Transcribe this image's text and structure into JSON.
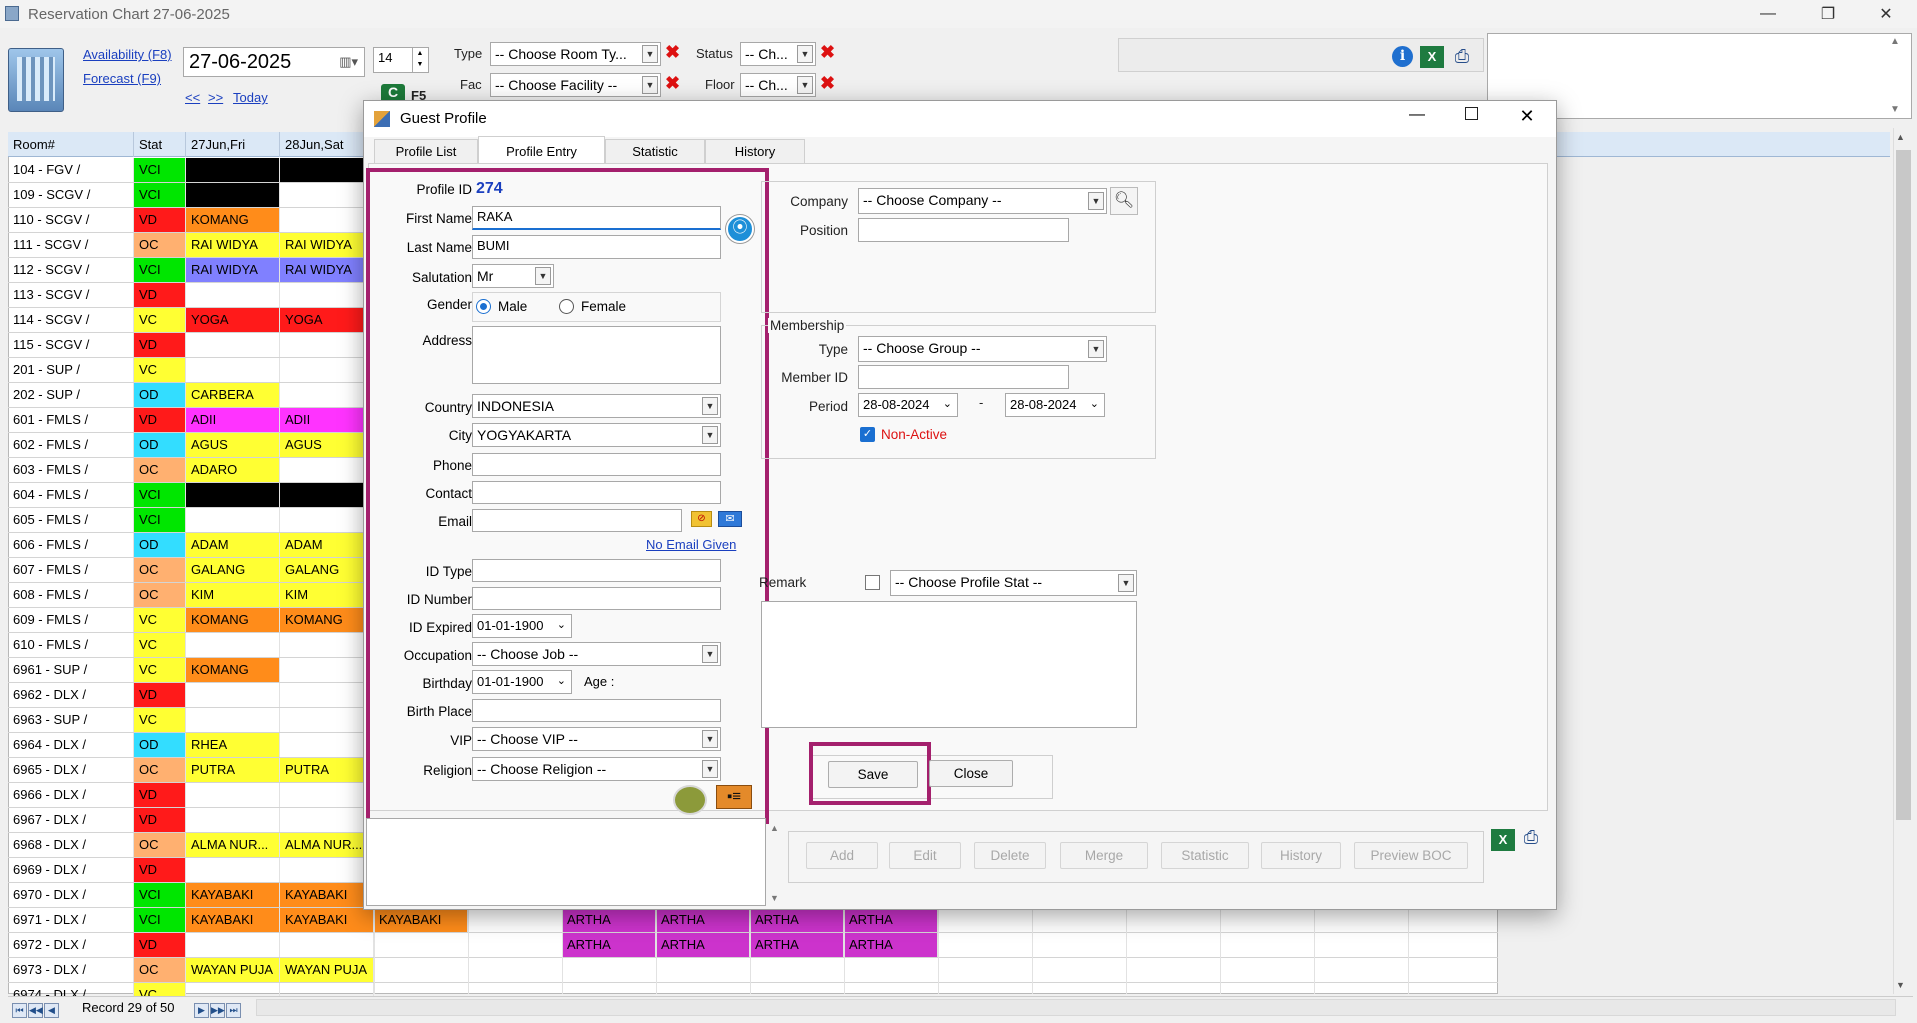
{
  "window": {
    "title": "Reservation Chart 27-06-2025",
    "min": "—",
    "max": "❐",
    "close": "✕"
  },
  "toolbar": {
    "availability": "Availability (F8)",
    "forecast": "Forecast (F9)",
    "prev": "<<",
    "next": ">>",
    "today": "Today",
    "date": "27-06-2025",
    "days": "14",
    "refresh_key": "F5",
    "type_label": "Type",
    "type_value": "-- Choose Room Ty...",
    "fac_label": "Fac",
    "fac_value": "-- Choose Facility --",
    "status_label": "Status",
    "status_value": "-- Ch...",
    "floor_label": "Floor",
    "floor_value": "-- Ch..."
  },
  "grid": {
    "headers": [
      "Room#",
      "Stat",
      "27Jun,Fri",
      "28Jun,Sat"
    ],
    "rows": [
      {
        "room": "104 - FGV /",
        "stat": "VCI",
        "sc": "#00e600",
        "c1": "",
        "c1c": "#000000",
        "c2": "",
        "c2c": "#000000"
      },
      {
        "room": "109 - SCGV /",
        "stat": "VCI",
        "sc": "#00e600",
        "c1": "",
        "c1c": "#000000",
        "c2": "",
        "c2c": ""
      },
      {
        "room": "110 - SCGV /",
        "stat": "VD",
        "sc": "#ff1a1a",
        "c1": "KOMANG",
        "c1c": "#ff8c1a",
        "c2": "",
        "c2c": ""
      },
      {
        "room": "111 - SCGV /",
        "stat": "OC",
        "sc": "#ffb070",
        "c1": "RAI WIDYA",
        "c1c": "#ffff33",
        "c2": "RAI WIDYA",
        "c2c": "#ffff33"
      },
      {
        "room": "112 - SCGV /",
        "stat": "VCI",
        "sc": "#00e600",
        "c1": "RAI WIDYA",
        "c1c": "#8080ff",
        "c2": "RAI WIDYA",
        "c2c": "#8080ff"
      },
      {
        "room": "113 - SCGV /",
        "stat": "VD",
        "sc": "#ff1a1a",
        "c1": "",
        "c1c": "",
        "c2": "",
        "c2c": ""
      },
      {
        "room": "114 - SCGV /",
        "stat": "VC",
        "sc": "#ffff33",
        "c1": "YOGA",
        "c1c": "#ff1a1a",
        "c2": "YOGA",
        "c2c": "#ff1a1a"
      },
      {
        "room": "115 - SCGV /",
        "stat": "VD",
        "sc": "#ff1a1a",
        "c1": "",
        "c1c": "",
        "c2": "",
        "c2c": ""
      },
      {
        "room": "201 - SUP /",
        "stat": "VC",
        "sc": "#ffff33",
        "c1": "",
        "c1c": "",
        "c2": "",
        "c2c": ""
      },
      {
        "room": "202 - SUP /",
        "stat": "OD",
        "sc": "#33ddff",
        "c1": "CARBERA",
        "c1c": "#ffff33",
        "c2": "",
        "c2c": ""
      },
      {
        "room": "601 - FMLS /",
        "stat": "VD",
        "sc": "#ff1a1a",
        "c1": "ADII",
        "c1c": "#ff33ff",
        "c2": "ADII",
        "c2c": "#ff33ff"
      },
      {
        "room": "602 - FMLS /",
        "stat": "OD",
        "sc": "#33ddff",
        "c1": "AGUS",
        "c1c": "#ffff33",
        "c2": "AGUS",
        "c2c": "#ffff33"
      },
      {
        "room": "603 - FMLS /",
        "stat": "OC",
        "sc": "#ffb070",
        "c1": "ADARO",
        "c1c": "#ffff33",
        "c2": "",
        "c2c": ""
      },
      {
        "room": "604 - FMLS /",
        "stat": "VCI",
        "sc": "#00e600",
        "c1": "",
        "c1c": "#000000",
        "c2": "",
        "c2c": "#000000"
      },
      {
        "room": "605 - FMLS /",
        "stat": "VCI",
        "sc": "#00e600",
        "c1": "",
        "c1c": "",
        "c2": "",
        "c2c": ""
      },
      {
        "room": "606 - FMLS /",
        "stat": "OD",
        "sc": "#33ddff",
        "c1": "ADAM",
        "c1c": "#ffff33",
        "c2": "ADAM",
        "c2c": "#ffff33"
      },
      {
        "room": "607 - FMLS /",
        "stat": "OC",
        "sc": "#ffb070",
        "c1": "GALANG",
        "c1c": "#ffff33",
        "c2": "GALANG",
        "c2c": "#ffff33"
      },
      {
        "room": "608 - FMLS /",
        "stat": "OC",
        "sc": "#ffb070",
        "c1": "KIM",
        "c1c": "#ffff33",
        "c2": "KIM",
        "c2c": "#ffff33"
      },
      {
        "room": "609 - FMLS /",
        "stat": "VC",
        "sc": "#ffff33",
        "c1": "KOMANG",
        "c1c": "#ff8c1a",
        "c2": "KOMANG",
        "c2c": "#ff8c1a"
      },
      {
        "room": "610 - FMLS /",
        "stat": "VC",
        "sc": "#ffff33",
        "c1": "",
        "c1c": "",
        "c2": "",
        "c2c": ""
      },
      {
        "room": "6961 - SUP /",
        "stat": "VC",
        "sc": "#ffff33",
        "c1": "KOMANG",
        "c1c": "#ff8c1a",
        "c2": "",
        "c2c": ""
      },
      {
        "room": "6962 - DLX /",
        "stat": "VD",
        "sc": "#ff1a1a",
        "c1": "",
        "c1c": "",
        "c2": "",
        "c2c": ""
      },
      {
        "room": "6963 - SUP /",
        "stat": "VC",
        "sc": "#ffff33",
        "c1": "",
        "c1c": "",
        "c2": "",
        "c2c": ""
      },
      {
        "room": "6964 - DLX /",
        "stat": "OD",
        "sc": "#33ddff",
        "c1": "RHEA",
        "c1c": "#ffff33",
        "c2": "",
        "c2c": ""
      },
      {
        "room": "6965 - DLX /",
        "stat": "OC",
        "sc": "#ffb070",
        "c1": "PUTRA",
        "c1c": "#ffff33",
        "c2": "PUTRA",
        "c2c": "#ffff33"
      },
      {
        "room": "6966 - DLX /",
        "stat": "VD",
        "sc": "#ff1a1a",
        "c1": "",
        "c1c": "",
        "c2": "",
        "c2c": ""
      },
      {
        "room": "6967 - DLX /",
        "stat": "VD",
        "sc": "#ff1a1a",
        "c1": "",
        "c1c": "",
        "c2": "",
        "c2c": ""
      },
      {
        "room": "6968 - DLX /",
        "stat": "OC",
        "sc": "#ffb070",
        "c1": "ALMA NUR...",
        "c1c": "#ffff33",
        "c2": "ALMA NUR...",
        "c2c": "#ffff33"
      },
      {
        "room": "6969 - DLX /",
        "stat": "VD",
        "sc": "#ff1a1a",
        "c1": "",
        "c1c": "",
        "c2": "",
        "c2c": ""
      },
      {
        "room": "6970 - DLX /",
        "stat": "VCI",
        "sc": "#00e600",
        "c1": "KAYABAKI",
        "c1c": "#ff8c1a",
        "c2": "KAYABAKI",
        "c2c": "#ff8c1a"
      },
      {
        "room": "6971 - DLX /",
        "stat": "VCI",
        "sc": "#00e600",
        "c1": "KAYABAKI",
        "c1c": "#ff8c1a",
        "c2": "KAYABAKI",
        "c2c": "#ff8c1a"
      },
      {
        "room": "6972 - DLX /",
        "stat": "VD",
        "sc": "#ff1a1a",
        "c1": "",
        "c1c": "",
        "c2": "",
        "c2c": ""
      },
      {
        "room": "6973 - DLX /",
        "stat": "OC",
        "sc": "#ffb070",
        "c1": "WAYAN PUJA",
        "c1c": "#ffff33",
        "c2": "WAYAN PUJA",
        "c2c": "#ffff33"
      },
      {
        "room": "6974 - DLX /",
        "stat": "VC",
        "sc": "#ffff33",
        "c1": "",
        "c1c": "",
        "c2": "",
        "c2c": ""
      }
    ],
    "extra": {
      "kayabaki": "KAYABAKI",
      "artha": "ARTHA"
    },
    "record": "Record 29 of 50"
  },
  "dialog": {
    "title": "Guest Profile",
    "tabs": [
      "Profile List",
      "Profile Entry",
      "Statistic",
      "History"
    ],
    "profile_id_label": "Profile ID",
    "profile_id": "274",
    "first_name_label": "First Name",
    "first_name": "RAKA",
    "last_name_label": "Last Name",
    "last_name": "BUMI",
    "salutation_label": "Salutation",
    "salutation": "Mr",
    "gender_label": "Gender",
    "male": "Male",
    "female": "Female",
    "address_label": "Address",
    "country_label": "Country",
    "country": "INDONESIA",
    "city_label": "City",
    "city": "YOGYAKARTA",
    "phone_label": "Phone",
    "contact_label": "Contact",
    "email_label": "Email",
    "no_email": "No Email Given",
    "id_type_label": "ID Type",
    "id_number_label": "ID Number",
    "id_expired_label": "ID Expired",
    "id_expired": "01-01-1900",
    "occupation_label": "Occupation",
    "occupation": "-- Choose Job --",
    "birthday_label": "Birthday",
    "birthday": "01-01-1900",
    "age_label": "Age :",
    "birth_place_label": "Birth Place",
    "vip_label": "VIP",
    "vip": "-- Choose VIP --",
    "religion_label": "Religion",
    "religion": "-- Choose Religion --",
    "company_label": "Company",
    "company": "-- Choose Company --",
    "position_label": "Position",
    "membership_label": "Membership",
    "type_label": "Type",
    "group": "-- Choose Group --",
    "member_id_label": "Member ID",
    "period_label": "Period",
    "period_from": "28-08-2024",
    "period_dash": "-",
    "period_to": "28-08-2024",
    "non_active": "Non-Active",
    "remark_label": "Remark",
    "profile_stat": "-- Choose Profile Stat --",
    "save": "Save",
    "close": "Close",
    "actions": [
      "Add",
      "Edit",
      "Delete",
      "Merge",
      "Statistic",
      "History",
      "Preview BOC"
    ]
  },
  "colors": {
    "highlight": "#a4206d",
    "accent": "#1a3fbf",
    "non_active": "#d11"
  }
}
